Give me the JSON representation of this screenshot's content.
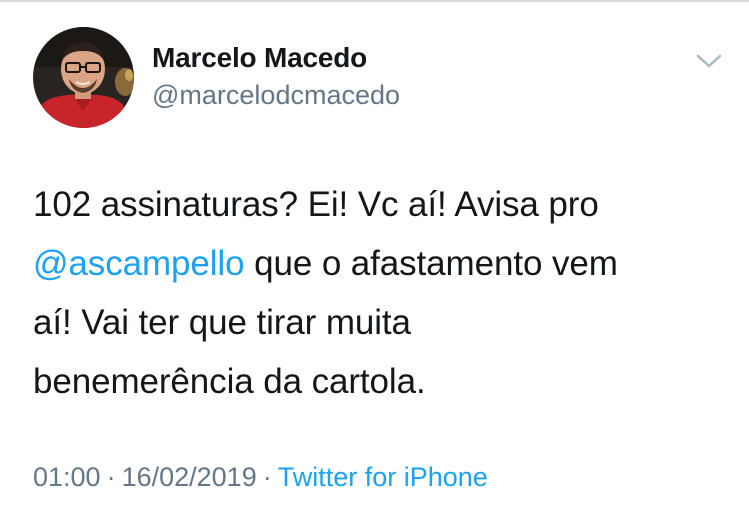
{
  "user": {
    "name": "Marcelo Macedo",
    "handle": "@marcelodcmacedo"
  },
  "tweet": {
    "line1": "102 assinaturas? Ei! Vc aí! Avisa pro",
    "mention": "@ascampello",
    "line2_rest": " que o afastamento vem",
    "line3": "aí! Vai ter que tirar muita",
    "line4": "benemerência da cartola."
  },
  "meta": {
    "time": "01:00",
    "separator1": "·",
    "date": "16/02/2019",
    "separator2": "·",
    "source": "Twitter for iPhone"
  },
  "icons": {
    "menu": "chevron-down-icon",
    "avatar": "profile-photo"
  },
  "colors": {
    "text": "#14171a",
    "secondary": "#657786",
    "link": "#1da1f2"
  }
}
